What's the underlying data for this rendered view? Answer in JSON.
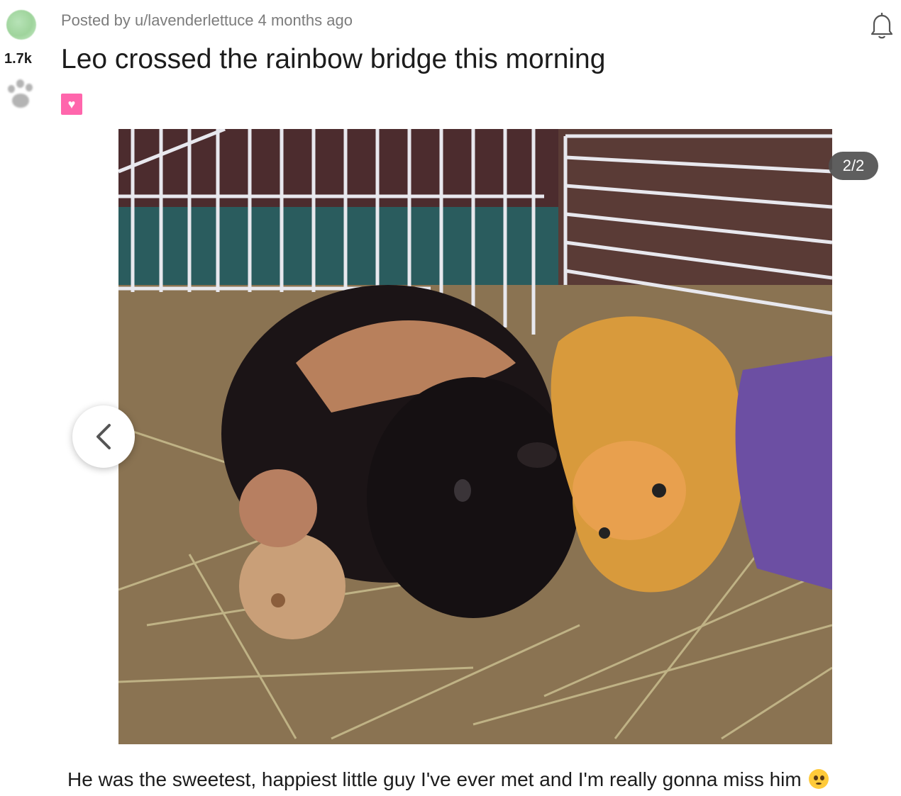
{
  "post": {
    "score": "1.7k",
    "posted_by": "Posted by u/lavenderlettuce 4 months ago",
    "title": "Leo crossed the rainbow bridge this morning",
    "flair_icon": "heart",
    "caption": "He was the sweetest, happiest little guy I've ever met and I'm really gonna miss him"
  },
  "gallery": {
    "counter": "2/2",
    "prev_icon": "chevron-left-icon"
  },
  "icons": {
    "bell": "bell-icon",
    "emoji": "pleading-face-emoji"
  },
  "colors": {
    "flair": "#ff66ac",
    "counter_bg": "#505050"
  }
}
